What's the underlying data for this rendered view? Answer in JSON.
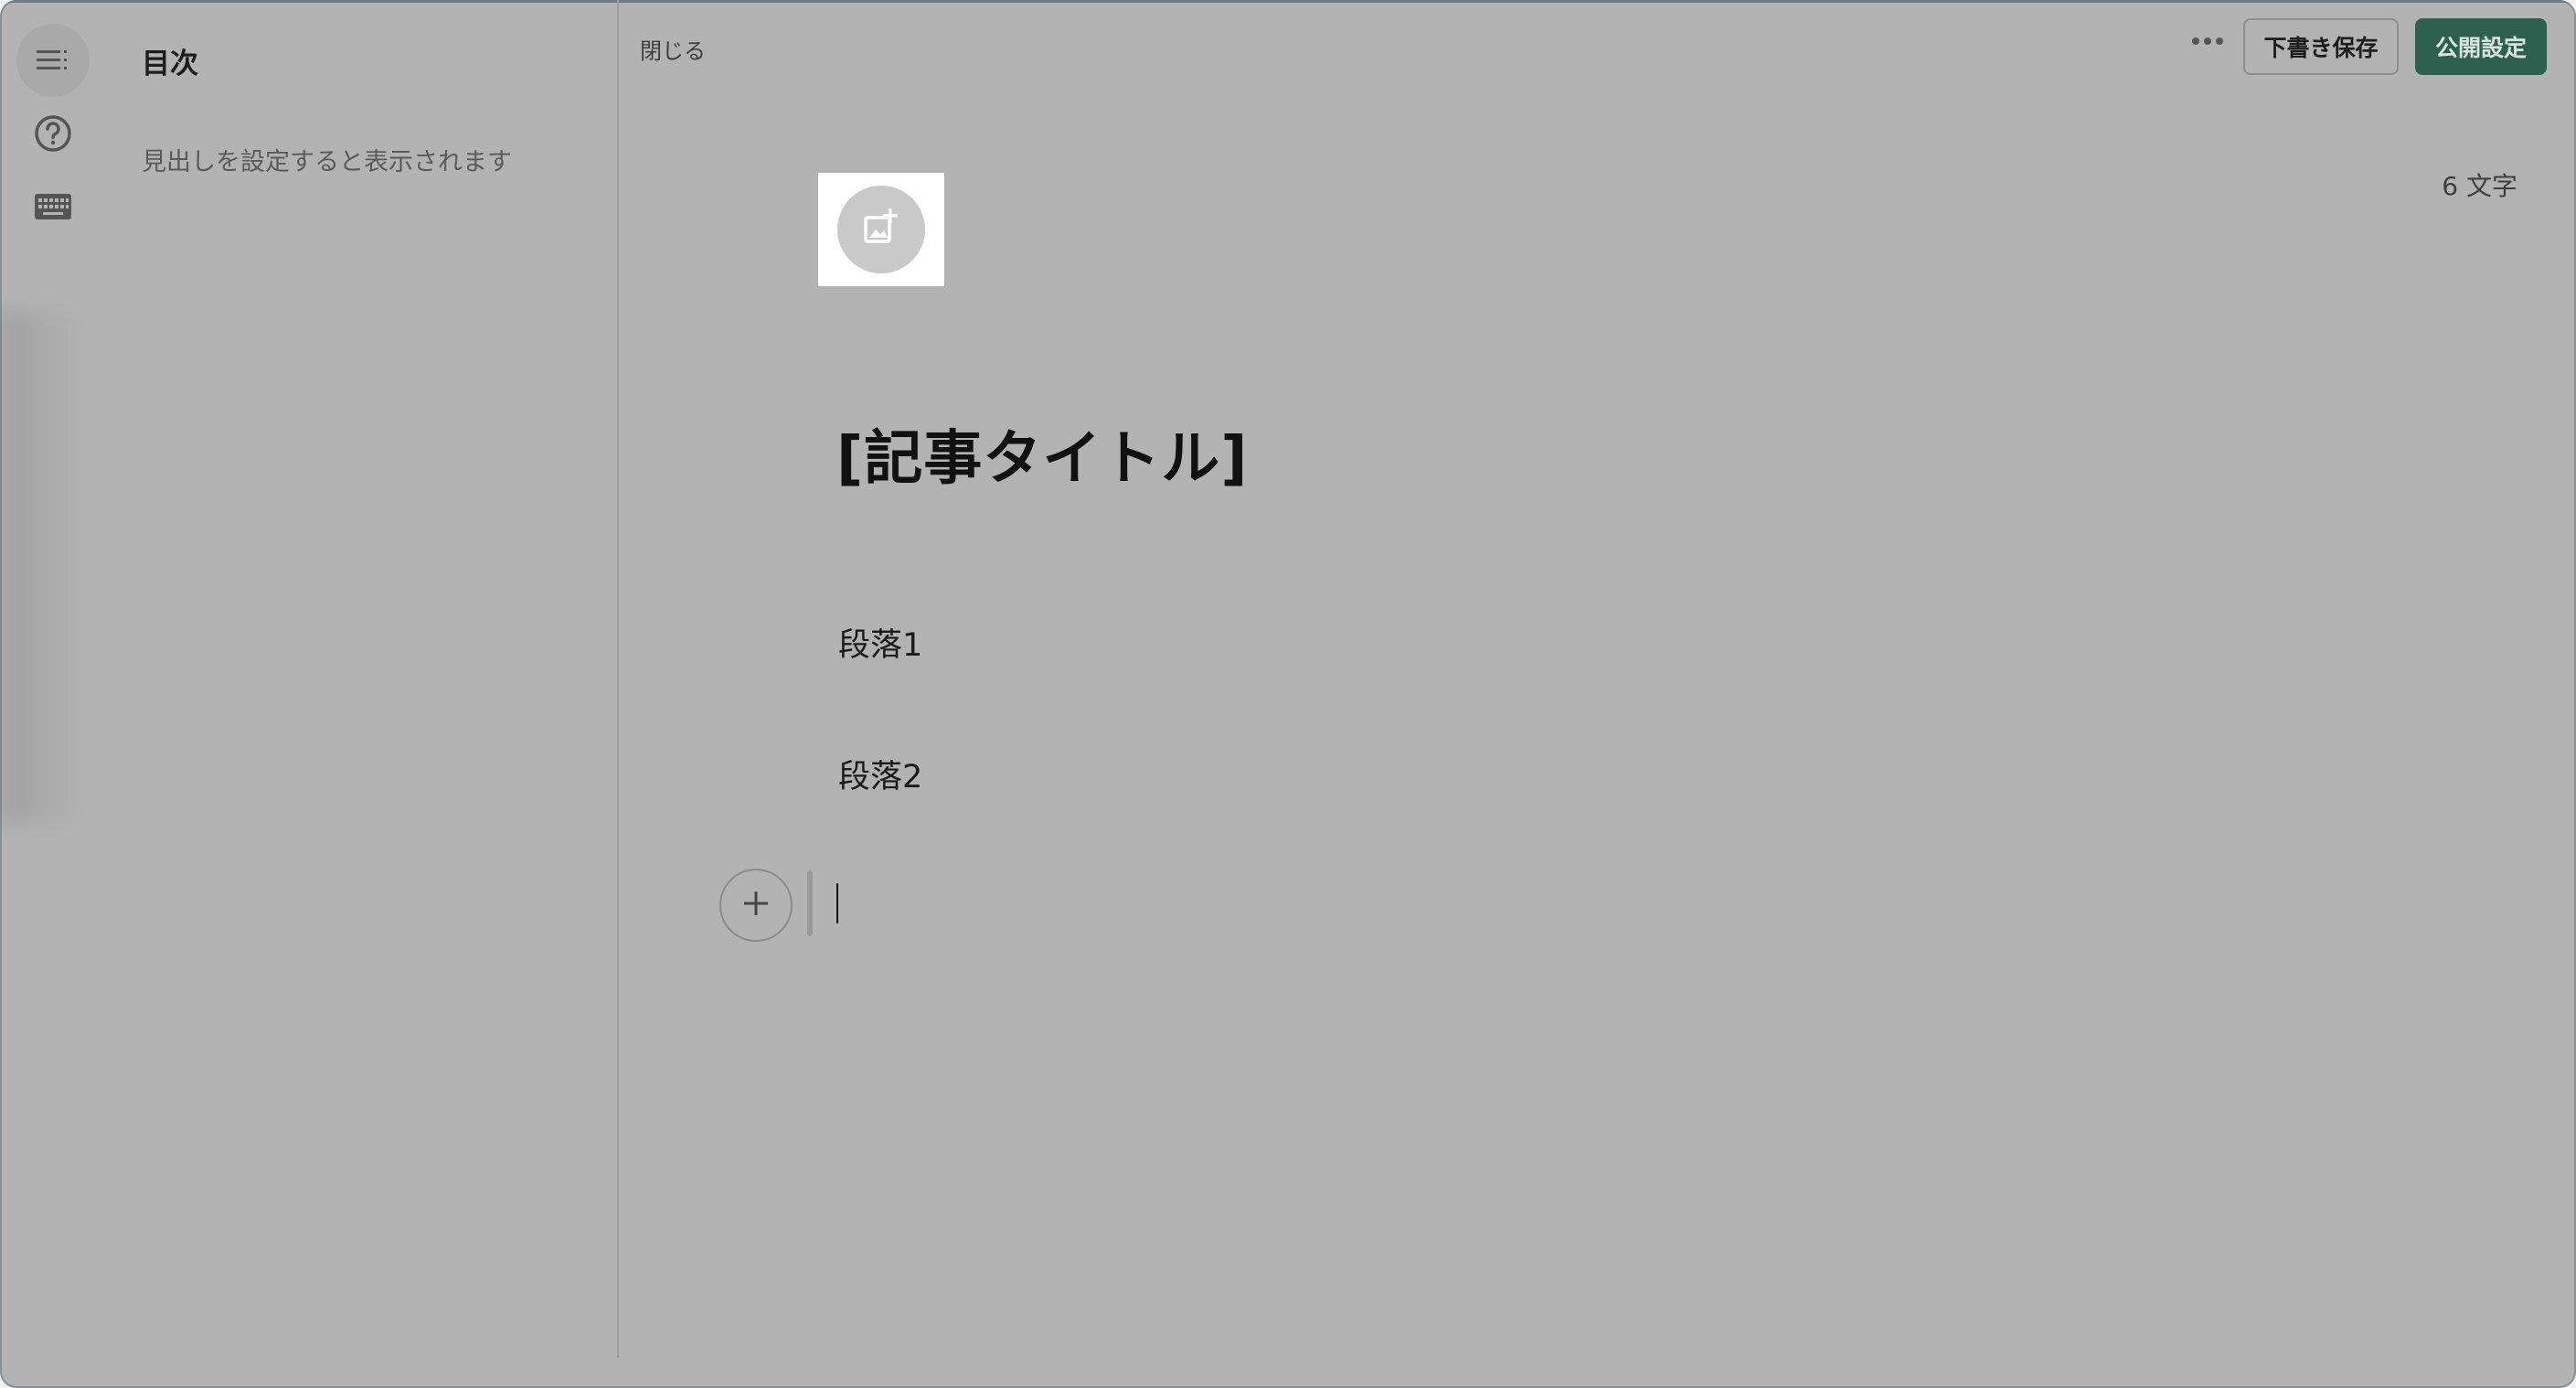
{
  "sidebar": {
    "toc_title": "目次",
    "toc_empty_message": "見出しを設定すると表示されます",
    "icons": [
      "toc-icon",
      "help-icon",
      "keyboard-icon"
    ]
  },
  "header": {
    "close_label": "閉じる",
    "more_icon": "more-horizontal-icon",
    "save_draft_label": "下書き保存",
    "publish_label": "公開設定"
  },
  "editor": {
    "char_count": "6 文字",
    "eyecatch_icon": "add-image-icon",
    "title": "[記事タイトル]",
    "paragraphs": [
      "段落1",
      "段落2"
    ],
    "add_block_icon": "plus-icon"
  },
  "colors": {
    "overlay_background": "#b3b3b3",
    "publish_button": "#2e6050",
    "publish_text": "#d9e3df"
  }
}
